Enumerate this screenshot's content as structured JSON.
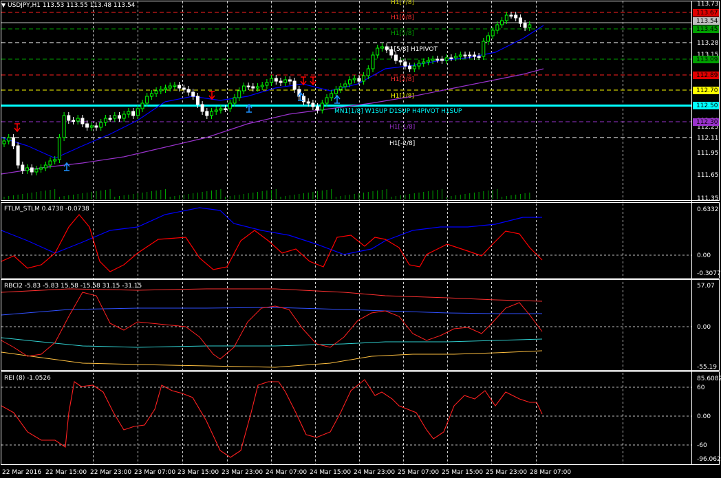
{
  "symbol_header": {
    "menu_icon": "triangle-down-icon",
    "text": "USDJPY,H1  113.53 113.55 113.48 113.54"
  },
  "colors": {
    "background": "#000000",
    "grid": "#ffffff",
    "candle_up": "#00ff00",
    "candle_down": "#ffffff",
    "ma_fast": "#0000ff",
    "ma_slow": "#9932cc",
    "ftlm": "#ff0000",
    "stlm": "#0000ff",
    "mn1_line": "#00ffff",
    "arrow_up": "#1e90ff",
    "arrow_down": "#ff0000"
  },
  "price_axis": {
    "labels": [
      "113.73",
      "113.54",
      "113.28",
      "113.15",
      "113.09",
      "112.89",
      "112.70",
      "112.50",
      "112.30",
      "112.25",
      "112.11",
      "111.95",
      "111.65",
      "111.35"
    ],
    "highlighted": [
      {
        "label": "113.67",
        "bg": "#e00000",
        "fg": "#000000"
      },
      {
        "label": "113.54",
        "bg": "#c0c0c0",
        "fg": "#000000"
      },
      {
        "label": "113.45",
        "bg": "#00a000",
        "fg": "#000000"
      },
      {
        "label": "113.09",
        "bg": "#00a000",
        "fg": "#000000"
      },
      {
        "label": "112.89",
        "bg": "#e00000",
        "fg": "#000000"
      },
      {
        "label": "112.70",
        "bg": "#ffff00",
        "fg": "#000000"
      },
      {
        "label": "112.50",
        "bg": "#00ffff",
        "fg": "#000000"
      },
      {
        "label": "112.30",
        "bg": "#9932cc",
        "fg": "#000000"
      }
    ]
  },
  "murrey_labels": [
    {
      "text": "H1[7/8]",
      "color": "#c8c800"
    },
    {
      "text": "H1[6/8]",
      "color": "#ff3030"
    },
    {
      "text": "H1[5/8]",
      "color": "#00a000"
    },
    {
      "text": "H1[5/8] H1PIVOT",
      "color": "#ffffff"
    },
    {
      "text": "H1[2/8]",
      "color": "#ff3030"
    },
    {
      "text": "H1[1/8]",
      "color": "#ffff00"
    },
    {
      "text": "MN1[1/8] W1SUP D1SUP H4PIVOT H1SUP",
      "color": "#00ffff"
    },
    {
      "text": "H1[-1/8]",
      "color": "#9932cc"
    },
    {
      "text": "H1[-2/8]",
      "color": "#ffffff"
    }
  ],
  "time_axis": [
    "22 Mar 2016",
    "22 Mar 15:00",
    "22 Mar 23:00",
    "23 Mar 07:00",
    "23 Mar 15:00",
    "23 Mar 23:00",
    "24 Mar 07:00",
    "24 Mar 15:00",
    "24 Mar 23:00",
    "25 Mar 07:00",
    "25 Mar 15:00",
    "25 Mar 23:00",
    "28 Mar 07:00"
  ],
  "ftlm_pane": {
    "title": "FTLM_STLM 0.4738 -0.0738",
    "axis": [
      "0.6332",
      "0.00",
      "-0.3077"
    ]
  },
  "rbci_pane": {
    "title": "RBCI2 -5.83 -5.83 15.58 -15.58 31.15 -31.15",
    "axis": [
      "57.07",
      "0.00",
      "-55.19"
    ]
  },
  "rei_pane": {
    "title": "REI (8) -1.0526",
    "axis": [
      "85.6082",
      "60",
      "0.00",
      "-60",
      "-96.0626"
    ]
  }
}
